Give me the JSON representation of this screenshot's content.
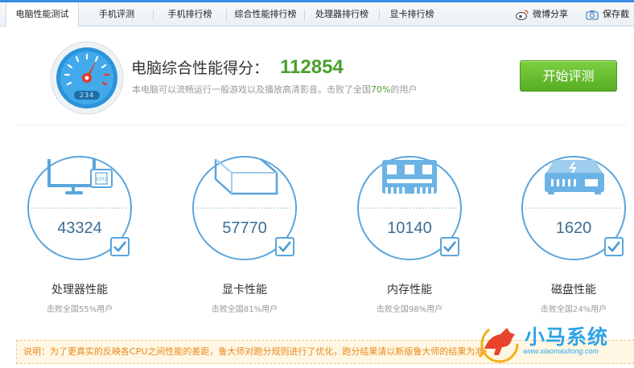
{
  "tabs": [
    {
      "label": "电脑性能测试",
      "active": true
    },
    {
      "label": "手机评测",
      "active": false
    },
    {
      "label": "手机排行榜",
      "active": false
    },
    {
      "label": "综合性能排行榜",
      "active": false
    },
    {
      "label": "处理器排行榜",
      "active": false
    },
    {
      "label": "显卡排行榜",
      "active": false
    }
  ],
  "share": {
    "weibo_label": "微博分享",
    "save_label": "保存截"
  },
  "header": {
    "score_title": "电脑综合性能得分：",
    "score_value": "112854",
    "gauge_digits": "234",
    "sub_prefix": "本电脑可以流畅运行一般游戏以及播放高清影音。击败了全国",
    "sub_percent": "70%",
    "sub_suffix": "的用户",
    "start_button": "开始评测"
  },
  "metrics": [
    {
      "value": "43324",
      "label": "处理器性能",
      "sub": "击败全国55%用户",
      "icon": "cpu-monitor-icon"
    },
    {
      "value": "57770",
      "label": "显卡性能",
      "sub": "击败全国81%用户",
      "icon": "graphics-cube-icon"
    },
    {
      "value": "10140",
      "label": "内存性能",
      "sub": "击败全国98%用户",
      "icon": "memory-chip-icon"
    },
    {
      "value": "1620",
      "label": "磁盘性能",
      "sub": "击败全国24%用户",
      "icon": "disk-drive-icon"
    }
  ],
  "notice": "说明：为了更真实的反映各CPU之间性能的差距，鲁大师对跑分规则进行了优化，跑分结果请以新版鲁大师的结果为准",
  "watermark": {
    "name": "小马系统",
    "url": "www.xiaomaxitong.com"
  },
  "colors": {
    "accent_green": "#4aa02c",
    "ring_blue": "#5aa5dc",
    "notice_orange": "#e8891c"
  }
}
